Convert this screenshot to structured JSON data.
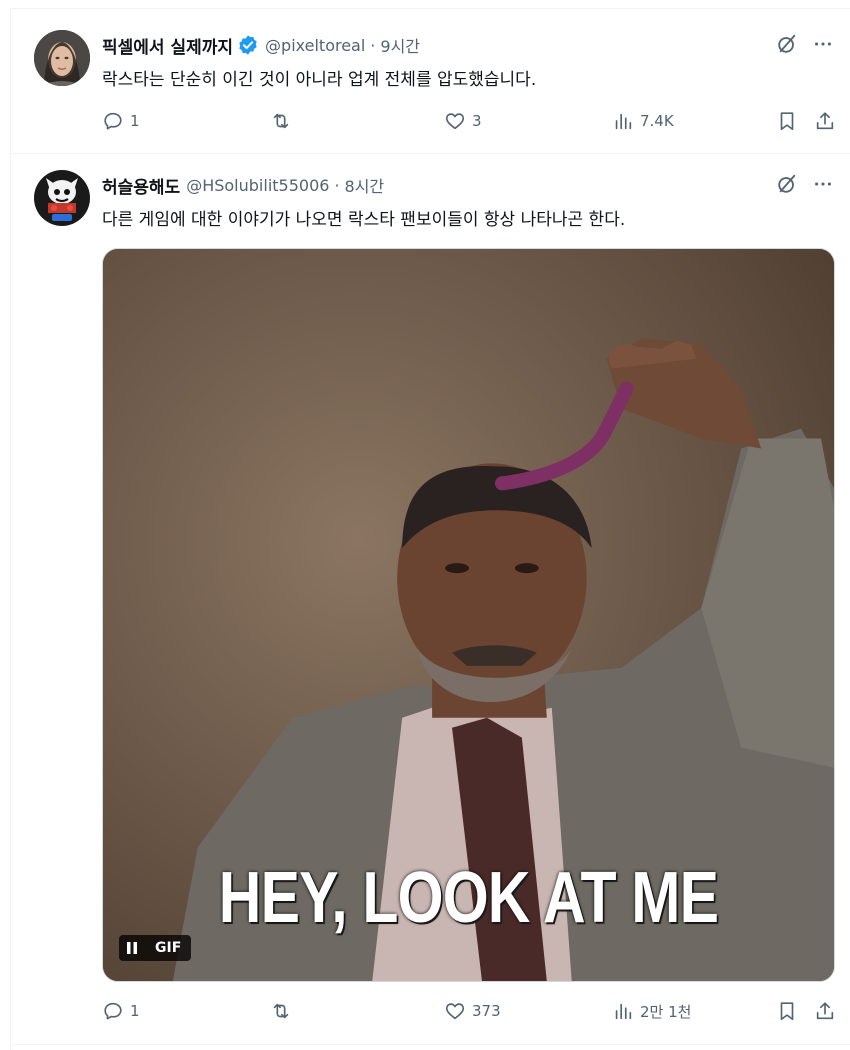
{
  "tweets": [
    {
      "display_name": "픽셀에서 실제까지",
      "handle": "@pixeltoreal",
      "separator": "·",
      "time": "9시간",
      "text": "락스타는 단순히 이긴 것이 아니라 업계 전체를 압도했습니다.",
      "verified": true,
      "replies": "1",
      "retweets": "",
      "likes": "3",
      "views": "7.4K"
    },
    {
      "display_name": "허슬용해도",
      "handle": "@HSolubilit55006",
      "separator": "·",
      "time": "8시간",
      "text": "다른 게임에 대한 이야기가 나오면 락스타 팬보이들이 항상 나타나곤 한다.",
      "verified": false,
      "media": {
        "caption": "HEY, LOOK AT ME",
        "badge": "GIF"
      },
      "replies": "1",
      "retweets": "",
      "likes": "373",
      "views": "2만 1천"
    }
  ],
  "colors": {
    "text_primary": "#0f1419",
    "text_secondary": "#536471",
    "verified_blue": "#1d9bf0",
    "divider": "#eff3f4"
  }
}
